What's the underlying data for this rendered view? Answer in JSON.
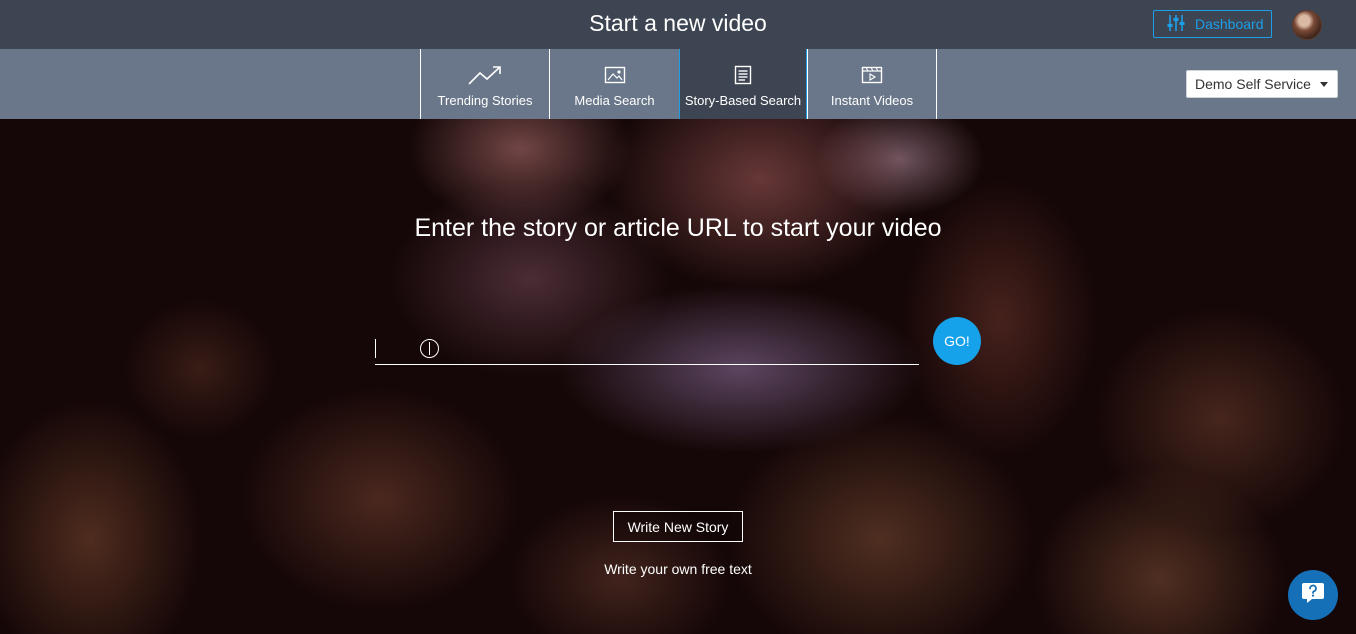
{
  "header": {
    "title": "Start a new video",
    "dashboard_label": "Dashboard",
    "dashboard_icon": "sliders-icon",
    "avatar": "user-avatar"
  },
  "nav": {
    "tabs": [
      {
        "label": "Trending Stories",
        "icon": "trending-up-icon",
        "active": false
      },
      {
        "label": "Media Search",
        "icon": "image-icon",
        "active": false
      },
      {
        "label": "Story-Based Search",
        "icon": "article-icon",
        "active": true
      },
      {
        "label": "Instant Videos",
        "icon": "video-clapper-icon",
        "active": false
      }
    ],
    "account_select": {
      "selected": "Demo Self Service"
    }
  },
  "main": {
    "headline": "Enter the story or article URL to start your video",
    "url_input": {
      "value": "",
      "placeholder": ""
    },
    "go_label": "GO!",
    "write_button": "Write New Story",
    "write_subtext": "Write your own free text"
  },
  "help": {
    "icon": "help-chat-icon"
  },
  "colors": {
    "topbar": "#3e4552",
    "navbar": "#6a7689",
    "accent": "#1d9ee8",
    "go_button": "#16a2ea",
    "help_button": "#1570b8"
  }
}
